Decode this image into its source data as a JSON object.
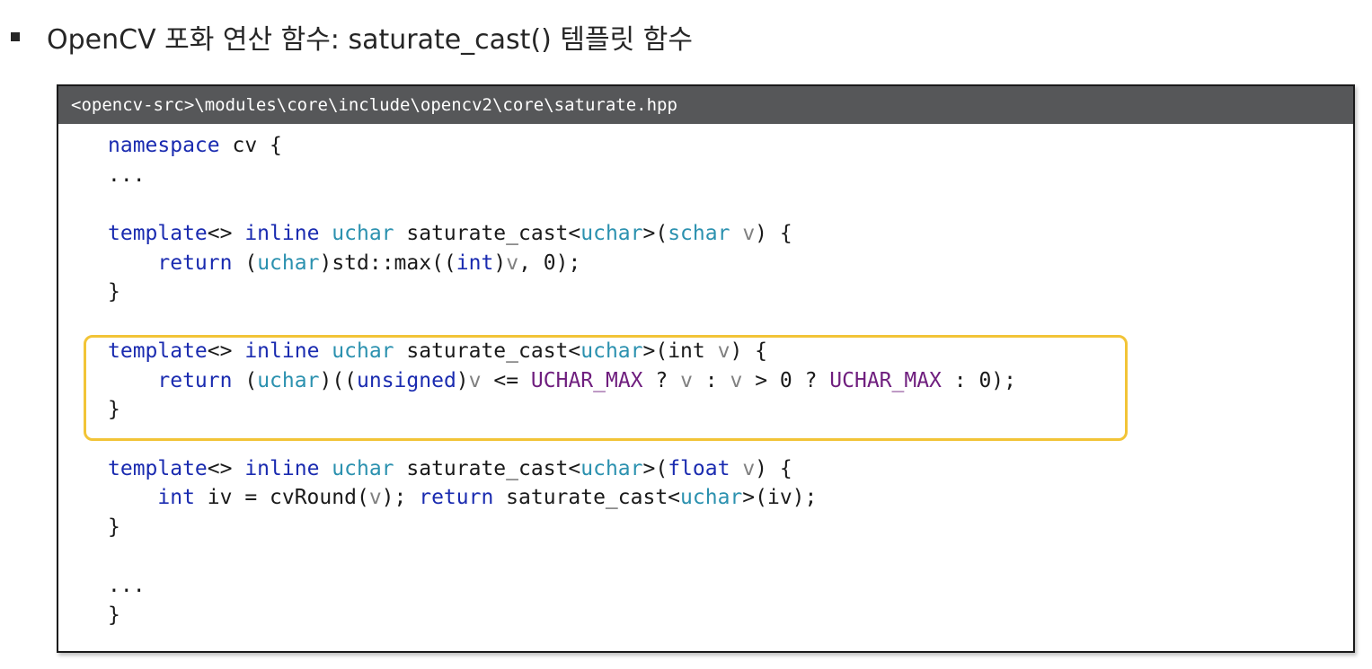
{
  "heading": {
    "bullet_icon": "square-bullet-icon",
    "text": "OpenCV 포화 연산 함수: saturate_cast() 템플릿 함수"
  },
  "panel": {
    "path": "<opencv-src>\\modules\\core\\include\\opencv2\\core\\saturate.hpp",
    "highlight_color": "#f2c437"
  },
  "code": {
    "ns_kw": "namespace",
    "ns_rest": " cv {",
    "ellipsis": "...",
    "template_kw": "template",
    "brackets": "<> ",
    "inline_kw": "inline",
    "uchar": "uchar",
    "func_open": " saturate_cast<",
    "close_angle_paren": ">(",
    "schar": "schar",
    "int_kw": "int",
    "float_kw": "float",
    "unsigned_kw": "unsigned",
    "v": "v",
    "close_brace_open": ") {",
    "return_kw": "return",
    "indent": "    ",
    "open_paren": "(",
    "close_paren": ")",
    "std_max_open": "std::max((",
    "comma_zero": ", 0);",
    "double_paren_open": "((",
    "le": " <= ",
    "uchar_max": "UCHAR_MAX",
    "question": " ? ",
    "colon": " : ",
    "gt_zero_q": " > 0 ? ",
    "colon_zero": " : 0);",
    "iv_assign": " iv = cvRound(",
    "paren_semi": "); ",
    "func_name_open": " saturate_cast<",
    "iv_close": ">(iv);",
    "close_brace": "}",
    "space": " "
  }
}
